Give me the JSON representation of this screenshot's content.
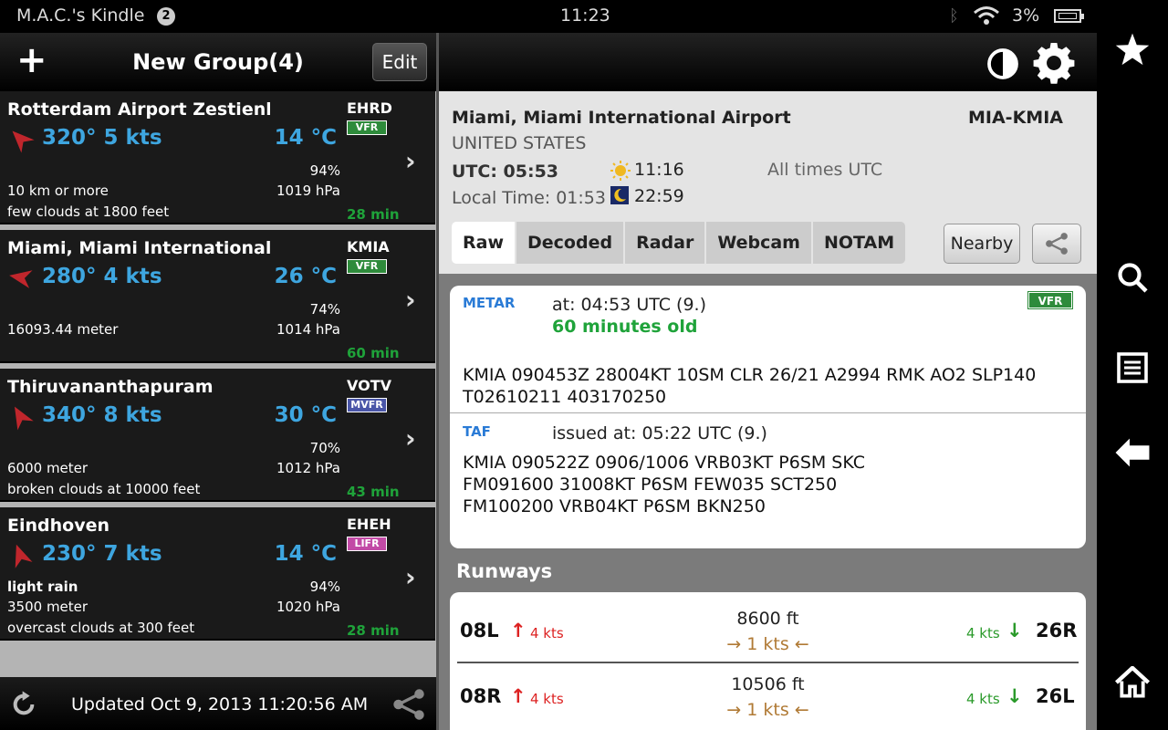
{
  "status": {
    "device_name": "M.A.C.'s Kindle",
    "notification_count": "2",
    "time": "11:23",
    "battery": "3%"
  },
  "group": {
    "title": "New Group(4)",
    "edit_label": "Edit",
    "updated": "Updated Oct 9, 2013 11:20:56 AM"
  },
  "stations": [
    {
      "name": "Rotterdam Airport Zestienho...",
      "code": "EHRD",
      "category": "VFR",
      "category_color": "#2e8b3b",
      "wind": "320° 5 kts",
      "temp": "14 °C",
      "humidity": "94%",
      "pressure": "1019 hPa",
      "line1": "10 km or more",
      "line2": "few clouds at 1800 feet",
      "line0": "",
      "age": "28 min"
    },
    {
      "name": "Miami, Miami International ...",
      "code": "KMIA",
      "category": "VFR",
      "category_color": "#2e8b3b",
      "wind": "280° 4 kts",
      "temp": "26 °C",
      "humidity": "74%",
      "pressure": "1014 hPa",
      "line1": "16093.44 meter",
      "line2": "",
      "line0": "",
      "age": "60 min"
    },
    {
      "name": "Thiruvananthapuram",
      "code": "VOTV",
      "category": "MVFR",
      "category_color": "#4a56a8",
      "wind": "340° 8 kts",
      "temp": "30 °C",
      "humidity": "70%",
      "pressure": "1012 hPa",
      "line1": "6000 meter",
      "line2": "broken clouds at 10000 feet",
      "line0": "",
      "age": "43 min"
    },
    {
      "name": "Eindhoven",
      "code": "EHEH",
      "category": "LIFR",
      "category_color": "#c24aa6",
      "wind": "230° 7 kts",
      "temp": "14 °C",
      "humidity": "94%",
      "pressure": "1020 hPa",
      "line0": "light rain",
      "line1": "3500 meter",
      "line2": "overcast clouds at 300 feet",
      "age": "28 min"
    }
  ],
  "detail": {
    "airport": "Miami, Miami International Airport",
    "ident": "MIA-KMIA",
    "country": "UNITED STATES",
    "utc": "UTC:  05:53",
    "sunrise": "11:16",
    "all_times": "All times UTC",
    "local": "Local Time:  01:53",
    "sunset": "22:59",
    "tabs": [
      "Raw",
      "Decoded",
      "Radar",
      "Webcam",
      "NOTAM"
    ],
    "nearby_label": "Nearby",
    "metar": {
      "label": "METAR",
      "at": "at: 04:53 UTC (9.)",
      "age": "60 minutes old",
      "category": "VFR",
      "raw": "KMIA 090453Z 28004KT 10SM CLR 26/21 A2994 RMK AO2 SLP140 T02610211 403170250"
    },
    "taf": {
      "label": "TAF",
      "issued": "issued at: 05:22 UTC  (9.)",
      "raw": "KMIA 090522Z 0906/1006 VRB03KT P6SM SKC FM091600 31008KT P6SM FEW035 SCT250 FM100200 VRB04KT P6SM BKN250"
    },
    "runways_title": "Runways",
    "runways": [
      {
        "left": "08L",
        "left_wind": "4  kts",
        "length": "8600 ft",
        "cross": "1  kts",
        "right_wind": "4  kts",
        "right": "26R"
      },
      {
        "left": "08R",
        "left_wind": "4  kts",
        "length": "10506 ft",
        "cross": "1  kts",
        "right_wind": "4  kts",
        "right": "26L"
      }
    ]
  },
  "colors": {
    "accent_blue": "#3ea6e0",
    "age_green": "#1fa33a"
  }
}
